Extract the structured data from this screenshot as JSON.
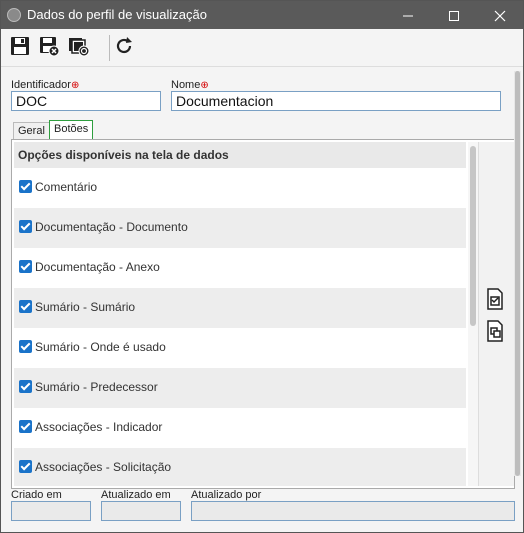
{
  "window": {
    "title": "Dados do perfil de visualização"
  },
  "header": {
    "identificador_label": "Identificador",
    "identificador_value": "DOC",
    "nome_label": "Nome",
    "nome_value": "Documentacion"
  },
  "tabs": [
    {
      "label": "Geral",
      "active": false
    },
    {
      "label": "Botões",
      "active": true
    }
  ],
  "list": {
    "header": "Opções disponíveis na tela de dados",
    "items": [
      {
        "label": "Comentário",
        "checked": true
      },
      {
        "label": "Documentação - Documento",
        "checked": true
      },
      {
        "label": "Documentação - Anexo",
        "checked": true
      },
      {
        "label": "Sumário - Sumário",
        "checked": true
      },
      {
        "label": "Sumário - Onde é usado",
        "checked": true
      },
      {
        "label": "Sumário - Predecessor",
        "checked": true
      },
      {
        "label": "Associações - Indicador",
        "checked": true
      },
      {
        "label": "Associações - Solicitação",
        "checked": true
      }
    ]
  },
  "footer": {
    "criado_em_label": "Criado em",
    "atualizado_em_label": "Atualizado em",
    "atualizado_por_label": "Atualizado por",
    "criado_em_value": "",
    "atualizado_em_value": "",
    "atualizado_por_value": ""
  },
  "icons": {
    "save": "floppy-disk-icon",
    "save_close": "floppy-disk-close-icon",
    "save_new": "floppy-disk-new-icon",
    "refresh": "refresh-icon",
    "select_all": "select-all-icon",
    "deselect_all": "deselect-all-icon"
  },
  "colors": {
    "titlebar": "#5a5a5a",
    "checkbox": "#1a73c9",
    "required": "#d40000",
    "active_tab": "#2e9e3e"
  }
}
